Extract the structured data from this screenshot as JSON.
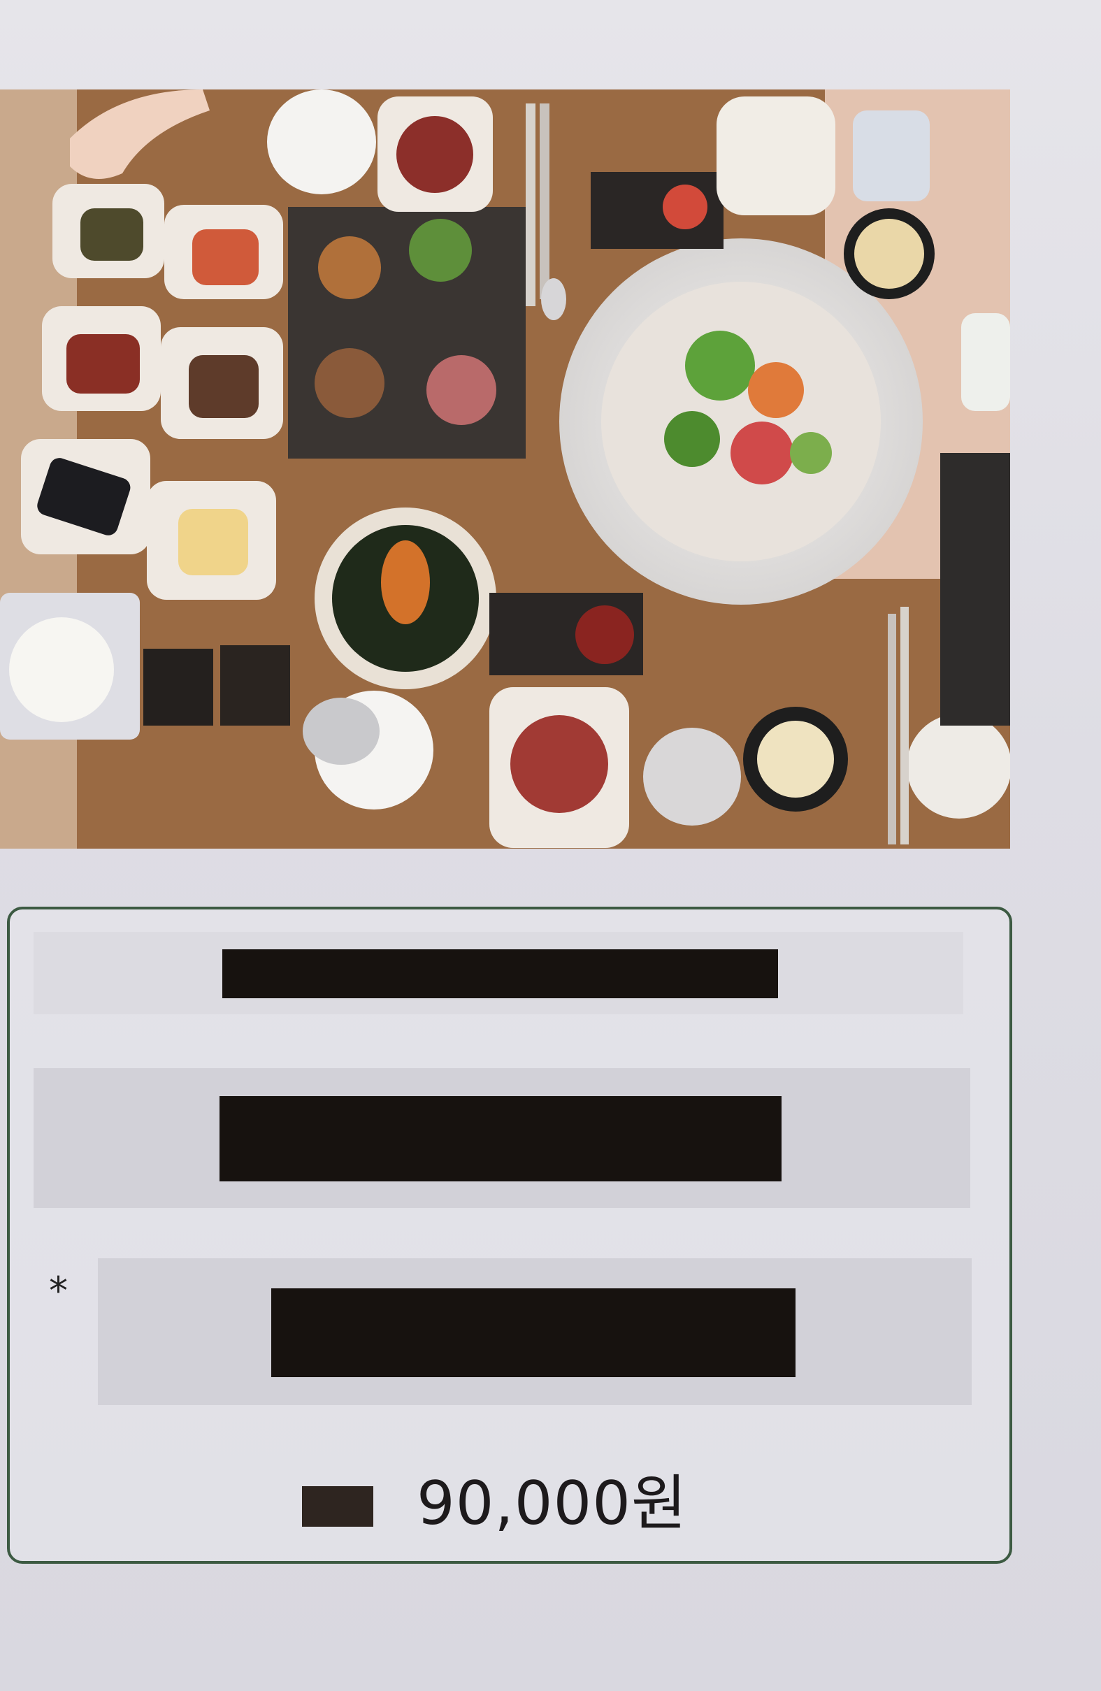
{
  "menu": {
    "note_marker": "*",
    "price": "90,000원"
  },
  "photo": {
    "icon": "table-spread-photo"
  }
}
